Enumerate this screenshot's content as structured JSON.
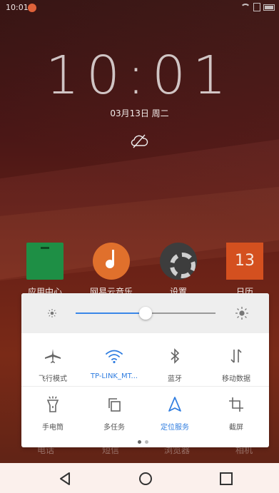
{
  "status_bar": {
    "time": "10:01",
    "icons": [
      "notification-dot-icon",
      "wifi-icon",
      "sim-icon",
      "battery-icon"
    ]
  },
  "lockscreen": {
    "clock": "10:01",
    "date": "03月13日  周二",
    "weather_icon": "weather-cloud-icon"
  },
  "home_apps": [
    {
      "label": "应用中心",
      "icon": "app-center-icon"
    },
    {
      "label": "网易云音乐",
      "icon": "netease-music-icon"
    },
    {
      "label": "设置",
      "icon": "settings-gear-icon"
    },
    {
      "label": "日历",
      "icon": "calendar-icon",
      "icon_text": "13"
    }
  ],
  "quick_settings": {
    "brightness": {
      "level": 0.5
    },
    "tiles_row1": [
      {
        "label": "飞行模式",
        "icon": "airplane-icon",
        "active": false
      },
      {
        "label": "TP-LINK_MT...",
        "icon": "wifi-icon",
        "active": true
      },
      {
        "label": "蓝牙",
        "icon": "bluetooth-icon",
        "active": false
      },
      {
        "label": "移动数据",
        "icon": "mobile-data-icon",
        "active": false
      }
    ],
    "tiles_row2": [
      {
        "label": "手电筒",
        "icon": "flashlight-icon",
        "active": false
      },
      {
        "label": "多任务",
        "icon": "multitask-icon",
        "active": false
      },
      {
        "label": "定位服务",
        "icon": "location-icon",
        "active": true
      },
      {
        "label": "截屏",
        "icon": "screenshot-crop-icon",
        "active": false
      }
    ],
    "page_count": 2,
    "current_page": 1
  },
  "dock_labels": [
    "电话",
    "短信",
    "浏览器",
    "相机"
  ],
  "nav_bar": {
    "buttons": [
      "back-icon",
      "home-icon",
      "recents-icon"
    ]
  },
  "colors": {
    "accent": "#2f7de0",
    "slider_fill": "#3a87e8"
  }
}
